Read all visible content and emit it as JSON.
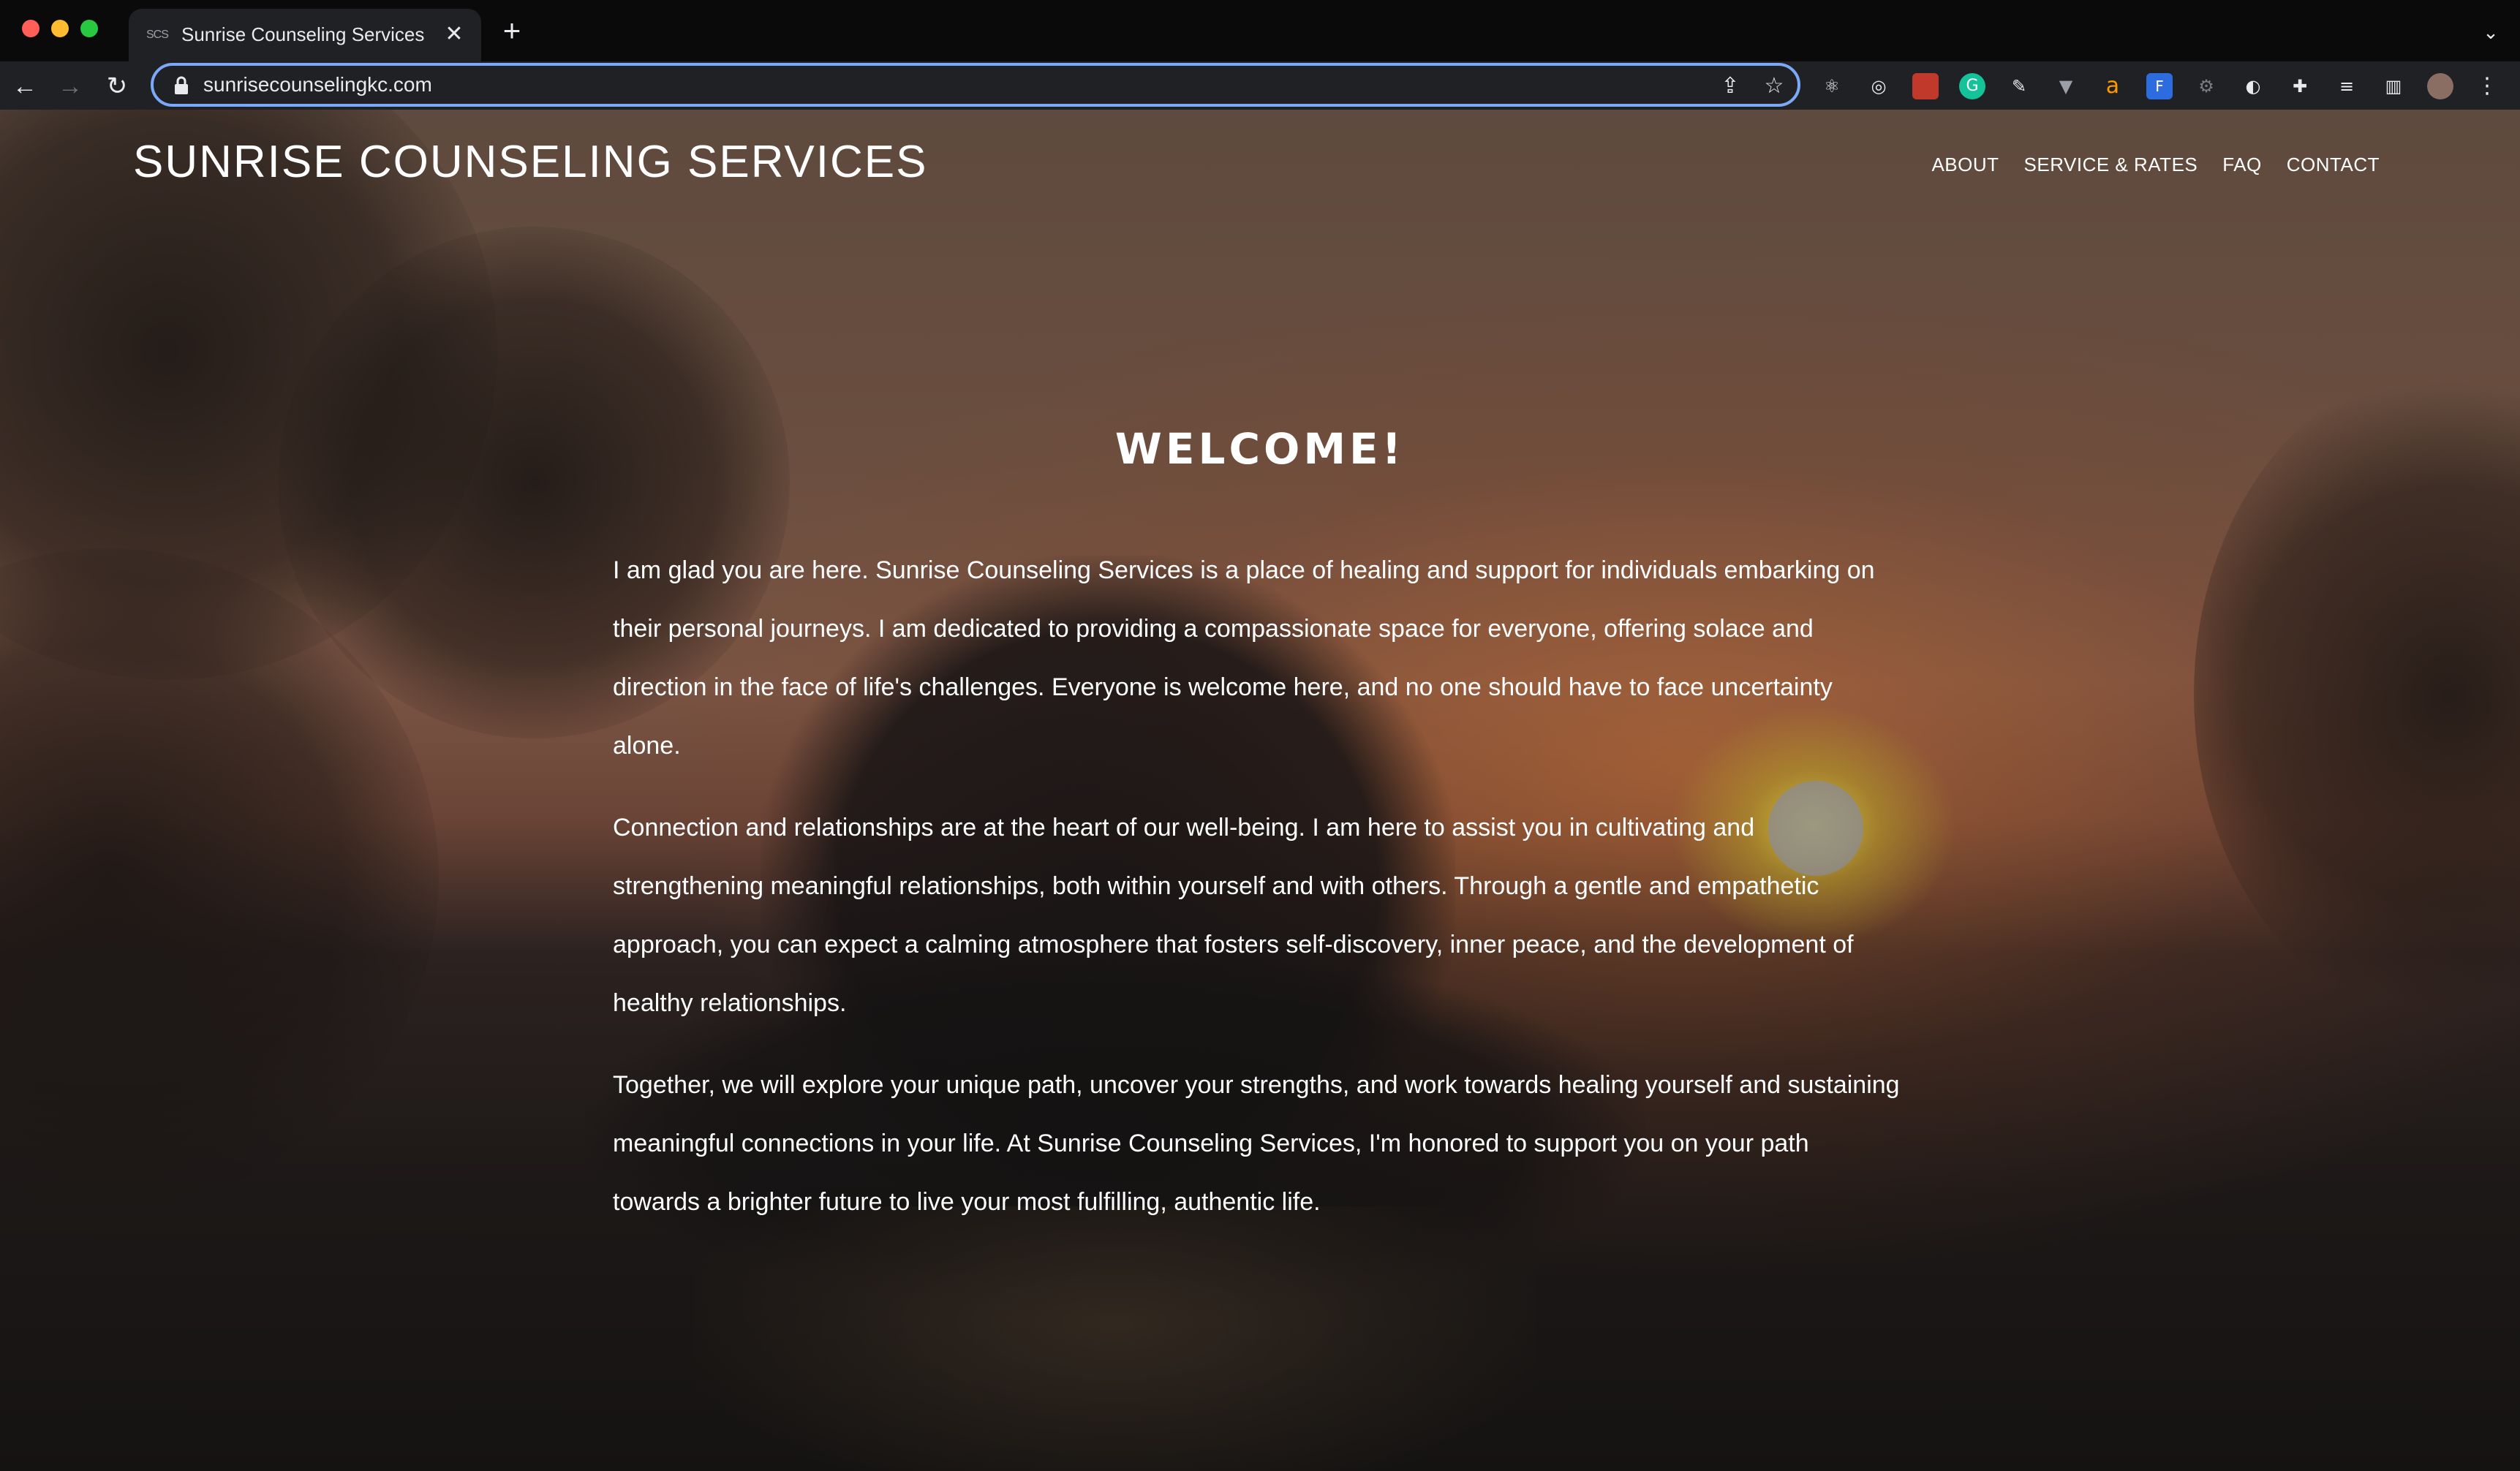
{
  "browser": {
    "tab": {
      "favicon_text": "SCS",
      "title": "Sunrise Counseling Services",
      "close": "✕"
    },
    "new_tab": "+",
    "address": {
      "url": "sunrisecounselingkc.com"
    }
  },
  "site": {
    "title": "SUNRISE COUNSELING SERVICES",
    "nav": [
      "ABOUT",
      "SERVICE & RATES",
      "FAQ",
      "CONTACT"
    ]
  },
  "main": {
    "heading": "WELCOME!",
    "paragraphs": [
      "I am glad you are here. Sunrise Counseling Services is a place of healing and support for individuals embarking on their personal journeys. I am dedicated to providing a compassionate space for everyone, offering solace and direction in the face of life's challenges. Everyone is welcome here, and no one should have to face uncertainty alone.",
      "Connection and relationships are at the heart of our well-being. I am here to assist you in cultivating and strengthening meaningful relationships, both within yourself and with others. Through a gentle and empathetic approach, you can expect a calming atmosphere that fosters self-discovery, inner peace, and the development of healthy relationships.",
      "Together, we will explore your unique path, uncover your strengths, and work towards healing yourself and sustaining meaningful connections in your life. At Sunrise Counseling Services, I'm honored to support you on your path towards a brighter future to live your most fulfilling, authentic life."
    ]
  },
  "colors": {
    "omnibox_border": "#7ca8f8",
    "chrome_bg": "#202124",
    "text": "#ffffff"
  }
}
